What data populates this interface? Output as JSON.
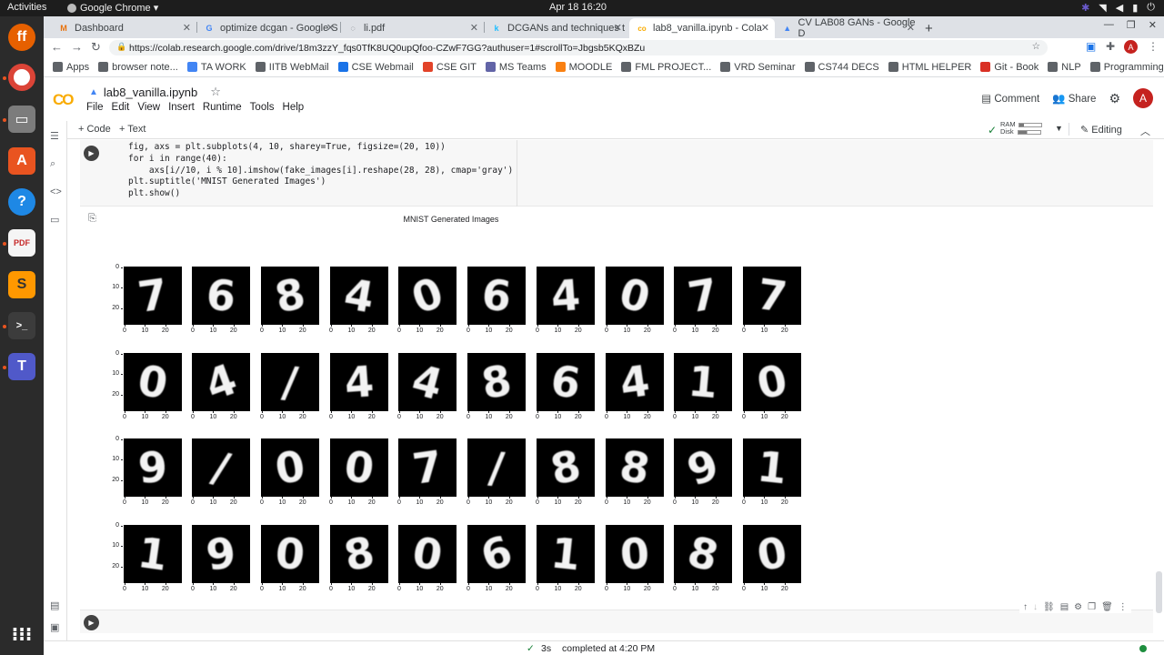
{
  "system_bar": {
    "activities": "Activities",
    "app_name": "Google Chrome ▾",
    "clock": "Apr 18  16:20"
  },
  "browser": {
    "tabs": [
      {
        "title": "Dashboard",
        "color": "#e8710a",
        "glyph": "M"
      },
      {
        "title": "optimize dcgan - Google S",
        "color": "#4285f4",
        "glyph": "G"
      },
      {
        "title": "li.pdf",
        "color": "#5f6368",
        "glyph": "◌"
      },
      {
        "title": "DCGANs and techniques t",
        "color": "#20beff",
        "glyph": "k"
      },
      {
        "title": "lab8_vanilla.ipynb - Cola",
        "color": "#f9ab00",
        "glyph": "co"
      },
      {
        "title": "CV LAB08 GANs - Google D",
        "color": "#4285f4",
        "glyph": "▲"
      }
    ],
    "url": "https://colab.research.google.com/drive/18m3zzY_fqs0TfK8UQ0upQfoo-CZwF7GG?authuser=1#scrollTo=Jbgsb5KQxBZu",
    "bookmarks": [
      {
        "label": "Apps",
        "color": "#5f6368"
      },
      {
        "label": "browser note...",
        "color": "#5f6368"
      },
      {
        "label": "TA WORK",
        "color": "#4285f4"
      },
      {
        "label": "IITB WebMail",
        "color": "#5f6368"
      },
      {
        "label": "CSE Webmail",
        "color": "#1a73e8"
      },
      {
        "label": "CSE GIT",
        "color": "#e24329"
      },
      {
        "label": "MS Teams",
        "color": "#6264a7"
      },
      {
        "label": "MOODLE",
        "color": "#f98012"
      },
      {
        "label": "FML PROJECT...",
        "color": "#5f6368"
      },
      {
        "label": "VRD Seminar",
        "color": "#5f6368"
      },
      {
        "label": "CS744 DECS",
        "color": "#5f6368"
      },
      {
        "label": "HTML HELPER",
        "color": "#5f6368"
      },
      {
        "label": "Git - Book",
        "color": "#d93025"
      },
      {
        "label": "NLP",
        "color": "#5f6368"
      },
      {
        "label": "Programming",
        "color": "#5f6368"
      }
    ]
  },
  "colab": {
    "logo": "CO",
    "notebook_title": "lab8_vanilla.ipynb",
    "menu": [
      "File",
      "Edit",
      "View",
      "Insert",
      "Runtime",
      "Tools",
      "Help"
    ],
    "comment": "Comment",
    "share": "Share",
    "avatar": "A",
    "add_code": "+ Code",
    "add_text": "+ Text",
    "ram_label": "RAM",
    "disk_label": "Disk",
    "editing": "Editing",
    "code_lines": [
      "fig, axs = plt.subplots(4, 10, sharey=True, figsize=(20, 10))",
      "for i in range(40):",
      "    axs[i//10, i % 10].imshow(fake_images[i].reshape(28, 28), cmap='gray')",
      "plt.suptitle('MNIST Generated Images')",
      "plt.show()"
    ],
    "figure_title": "MNIST Generated Images",
    "y_ticks": [
      "0",
      "10",
      "20"
    ],
    "x_ticks": [
      "0",
      "10",
      "20"
    ],
    "digits": [
      [
        "7",
        "6",
        "8",
        "4",
        "0",
        "6",
        "4",
        "0",
        "7",
        "7"
      ],
      [
        "0",
        "4",
        "/",
        "4",
        "4",
        "8",
        "6",
        "4",
        "1",
        "0"
      ],
      [
        "9",
        "/",
        "0",
        "0",
        "7",
        "/",
        "8",
        "8",
        "9",
        "1"
      ],
      [
        "1",
        "9",
        "0",
        "8",
        "0",
        "6",
        "1",
        "0",
        "8",
        "0"
      ]
    ],
    "status_time": "3s",
    "status_text": "completed at 4:20 PM"
  }
}
